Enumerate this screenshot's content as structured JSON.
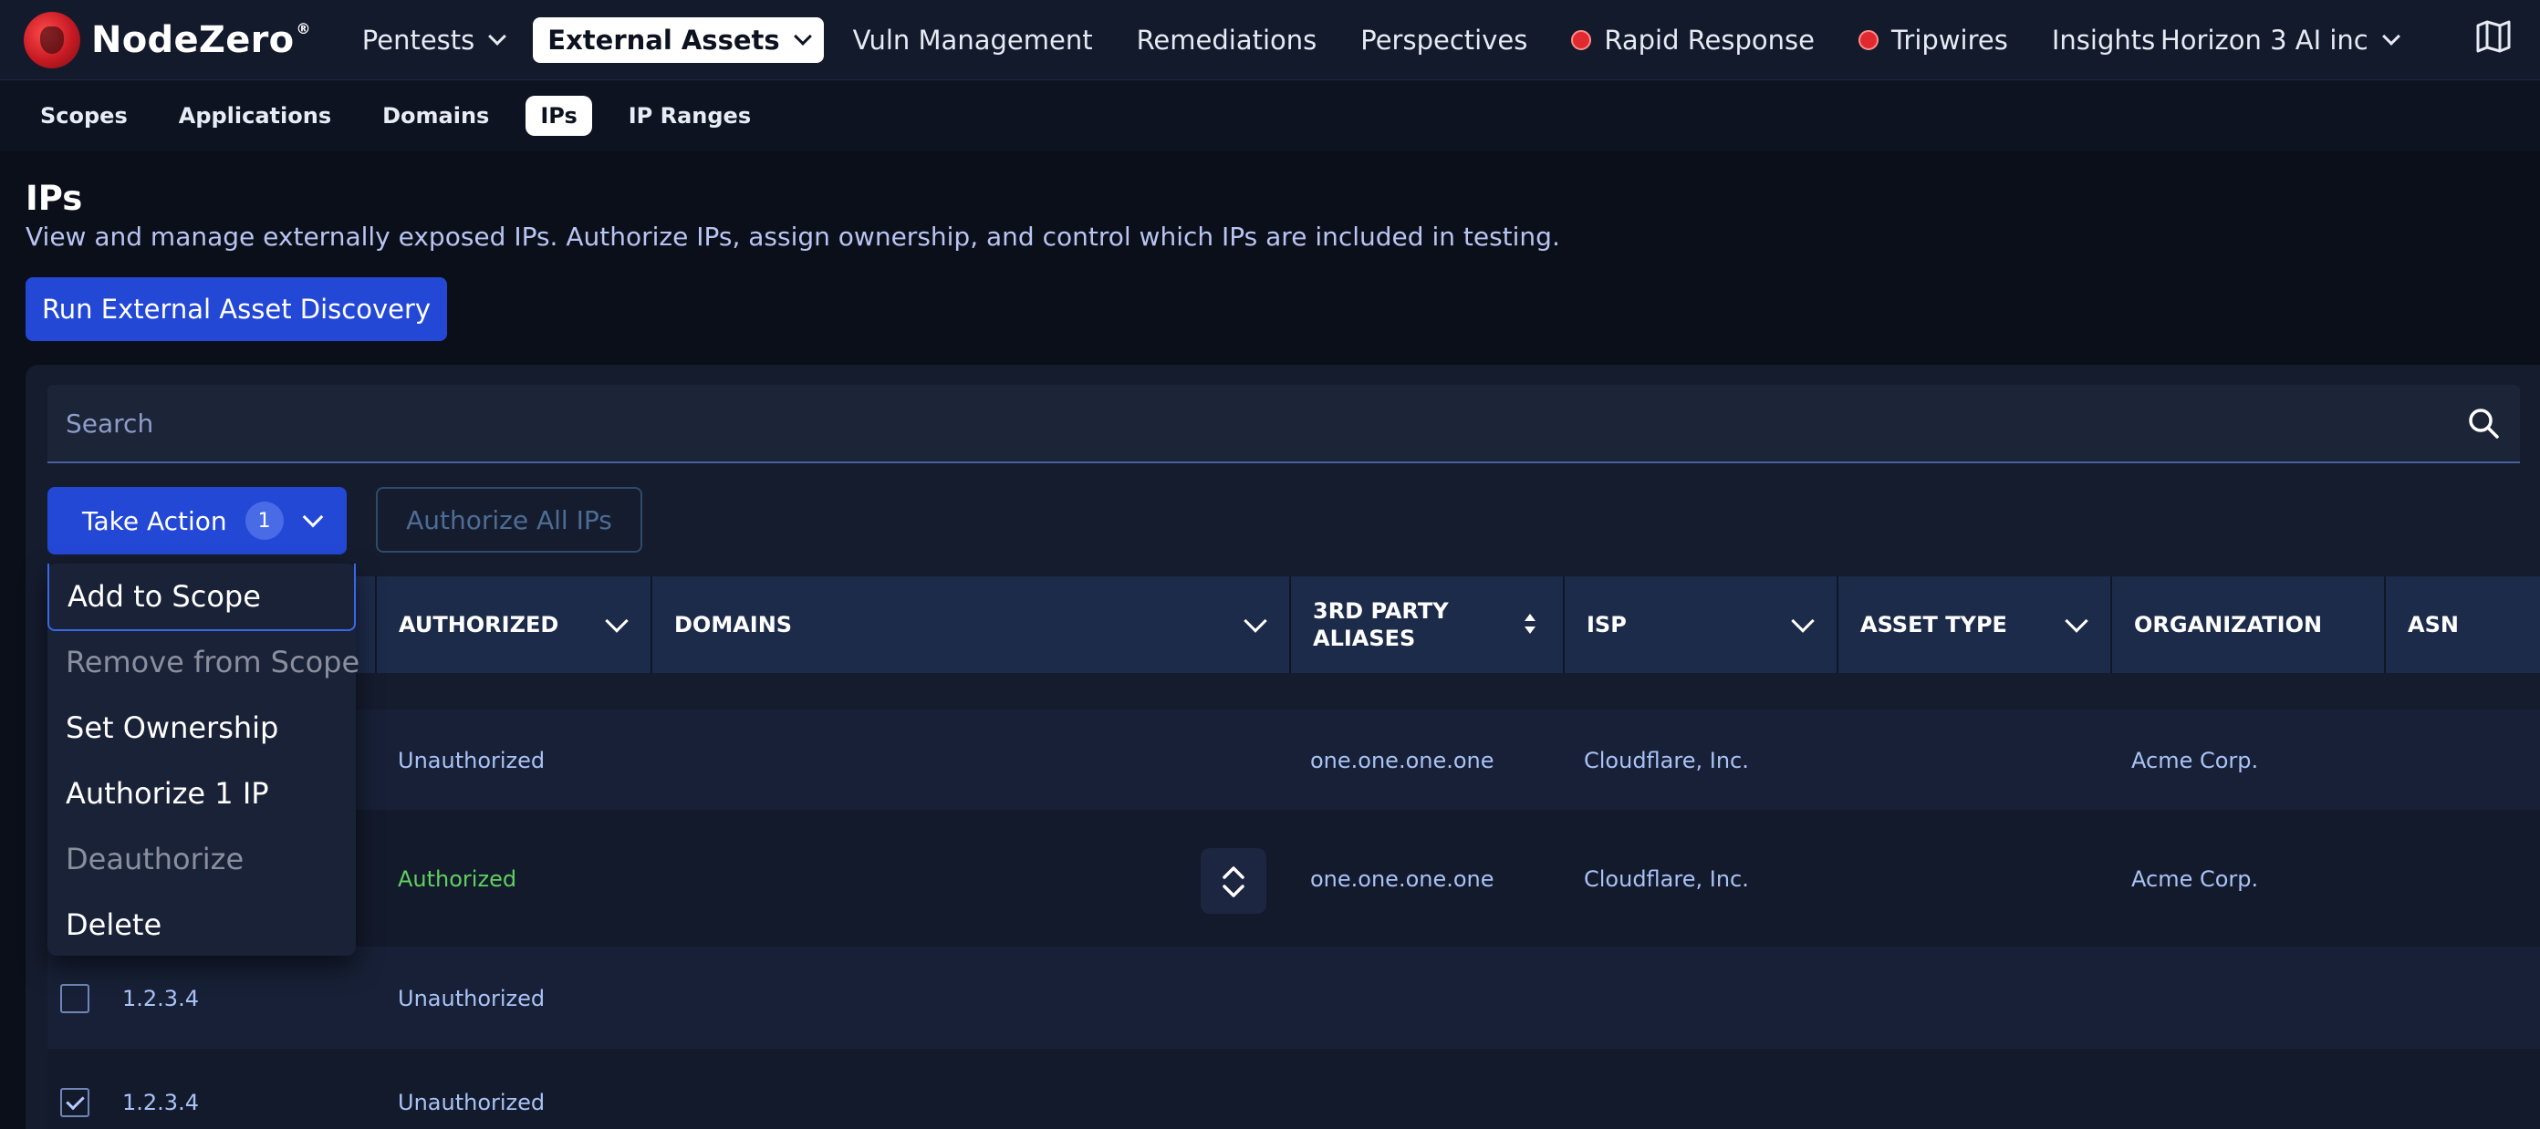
{
  "brand": {
    "name": "NodeZero",
    "mark": "®",
    "logo_color": "#d8232a"
  },
  "topnav": {
    "items": [
      {
        "label": "Pentests",
        "has_dropdown": true
      },
      {
        "label": "External Assets",
        "has_dropdown": true,
        "active": true
      },
      {
        "label": "Vuln Management"
      },
      {
        "label": "Remediations"
      },
      {
        "label": "Perspectives"
      },
      {
        "label": "Rapid Response",
        "dot": "#e02a2f"
      },
      {
        "label": "Tripwires",
        "dot": "#e02a2f"
      },
      {
        "label": "Insights"
      }
    ],
    "org": "Horizon 3 AI inc",
    "map_icon": "map-icon"
  },
  "subnav": {
    "tabs": [
      "Scopes",
      "Applications",
      "Domains",
      "IPs",
      "IP Ranges"
    ],
    "active": "IPs"
  },
  "page": {
    "title": "IPs",
    "description": "View and manage externally exposed IPs. Authorize IPs, assign ownership, and control which IPs are included in testing.",
    "run_button": "Run External Asset Discovery"
  },
  "search": {
    "placeholder": "Search",
    "icon": "search-icon"
  },
  "actions": {
    "take_action": "Take Action",
    "selected_count": "1",
    "authorize_all": "Authorize All IPs"
  },
  "menu": {
    "items": [
      {
        "label": "Add to Scope",
        "disabled": false,
        "focused": true
      },
      {
        "label": "Remove from Scope",
        "disabled": true
      },
      {
        "label": "Set Ownership",
        "disabled": false
      },
      {
        "label": "Authorize 1 IP",
        "disabled": false
      },
      {
        "label": "Deauthorize",
        "disabled": true
      },
      {
        "label": "Delete",
        "disabled": false
      }
    ]
  },
  "table": {
    "columns": [
      "AUTHORIZED",
      "DOMAINS",
      "3RD PARTY ALIASES",
      "ISP",
      "ASSET TYPE",
      "ORGANIZATION",
      "ASN"
    ],
    "rows": [
      {
        "ip": "",
        "authorized": "Unauthorized",
        "aliases": "one.one.one.one",
        "isp": "Cloudflare, Inc.",
        "organization": "Acme Corp.",
        "checked": false
      },
      {
        "ip": "",
        "authorized": "Authorized",
        "aliases": "one.one.one.one",
        "isp": "Cloudflare, Inc.",
        "organization": "Acme Corp.",
        "checked": false
      },
      {
        "ip": "1.2.3.4",
        "authorized": "Unauthorized",
        "aliases": "",
        "isp": "",
        "organization": "",
        "checked": false
      },
      {
        "ip": "1.2.3.4",
        "authorized": "Unauthorized",
        "aliases": "",
        "isp": "",
        "organization": "",
        "checked": true
      }
    ]
  },
  "colors": {
    "primary": "#2448d6",
    "authorized": "#5fd05f",
    "link": "#a9c2f5"
  }
}
